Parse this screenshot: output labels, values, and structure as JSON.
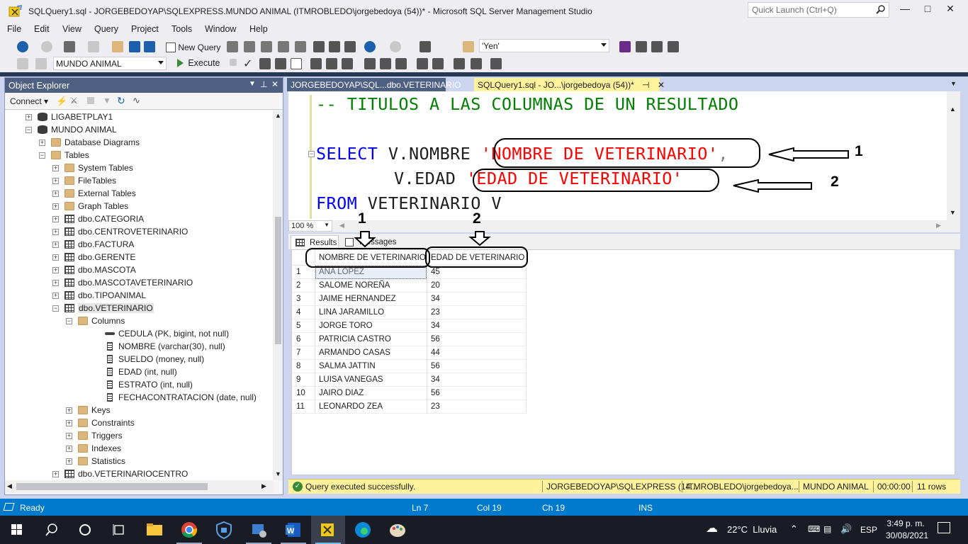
{
  "window": {
    "title": "SQLQuery1.sql - JORGEBEDOYAP\\SQLEXPRESS.MUNDO ANIMAL (ITMROBLEDO\\jorgebedoya (54))* - Microsoft SQL Server Management Studio"
  },
  "quick_launch": {
    "placeholder": "Quick Launch (Ctrl+Q)"
  },
  "menu": [
    "File",
    "Edit",
    "View",
    "Query",
    "Project",
    "Tools",
    "Window",
    "Help"
  ],
  "toolbar": {
    "new_query": "New Query",
    "search_combo": "'Yen'",
    "database": "MUNDO ANIMAL",
    "execute": "Execute"
  },
  "object_explorer": {
    "title": "Object Explorer",
    "connect": "Connect",
    "tree": [
      {
        "label": "LIGABETPLAY1",
        "icon": "database-icon",
        "exp": "+",
        "level": 0
      },
      {
        "label": "MUNDO ANIMAL",
        "icon": "database-icon",
        "exp": "-",
        "level": 0
      },
      {
        "label": "Database Diagrams",
        "icon": "folder-icon",
        "exp": "+",
        "level": 1
      },
      {
        "label": "Tables",
        "icon": "folder-icon",
        "exp": "-",
        "level": 1
      },
      {
        "label": "System Tables",
        "icon": "folder-icon",
        "exp": "+",
        "level": 2
      },
      {
        "label": "FileTables",
        "icon": "folder-icon",
        "exp": "+",
        "level": 2
      },
      {
        "label": "External Tables",
        "icon": "folder-icon",
        "exp": "+",
        "level": 2
      },
      {
        "label": "Graph Tables",
        "icon": "folder-icon",
        "exp": "+",
        "level": 2
      },
      {
        "label": "dbo.CATEGORIA",
        "icon": "table-icon",
        "exp": "+",
        "level": 2
      },
      {
        "label": "dbo.CENTROVETERINARIO",
        "icon": "table-icon",
        "exp": "+",
        "level": 2
      },
      {
        "label": "dbo.FACTURA",
        "icon": "table-icon",
        "exp": "+",
        "level": 2
      },
      {
        "label": "dbo.GERENTE",
        "icon": "table-icon",
        "exp": "+",
        "level": 2
      },
      {
        "label": "dbo.MASCOTA",
        "icon": "table-icon",
        "exp": "+",
        "level": 2
      },
      {
        "label": "dbo.MASCOTAVETERINARIO",
        "icon": "table-icon",
        "exp": "+",
        "level": 2
      },
      {
        "label": "dbo.TIPOANIMAL",
        "icon": "table-icon",
        "exp": "+",
        "level": 2
      },
      {
        "label": "dbo.VETERINARIO",
        "icon": "table-icon",
        "exp": "-",
        "level": 2
      },
      {
        "label": "Columns",
        "icon": "folder-icon",
        "exp": "-",
        "level": 3
      },
      {
        "label": "CEDULA (PK, bigint, not null)",
        "icon": "key-icon",
        "exp": "",
        "level": 4
      },
      {
        "label": "NOMBRE (varchar(30), null)",
        "icon": "column-icon",
        "exp": "",
        "level": 4
      },
      {
        "label": "SUELDO (money, null)",
        "icon": "column-icon",
        "exp": "",
        "level": 4
      },
      {
        "label": "EDAD (int, null)",
        "icon": "column-icon",
        "exp": "",
        "level": 4
      },
      {
        "label": "ESTRATO (int, null)",
        "icon": "column-icon",
        "exp": "",
        "level": 4
      },
      {
        "label": "FECHACONTRATACION (date, null)",
        "icon": "column-icon",
        "exp": "",
        "level": 4
      },
      {
        "label": "Keys",
        "icon": "folder-icon",
        "exp": "+",
        "level": 3
      },
      {
        "label": "Constraints",
        "icon": "folder-icon",
        "exp": "+",
        "level": 3
      },
      {
        "label": "Triggers",
        "icon": "folder-icon",
        "exp": "+",
        "level": 3
      },
      {
        "label": "Indexes",
        "icon": "folder-icon",
        "exp": "+",
        "level": 3
      },
      {
        "label": "Statistics",
        "icon": "folder-icon",
        "exp": "+",
        "level": 3
      },
      {
        "label": "dbo.VETERINARIOCENTRO",
        "icon": "table-icon",
        "exp": "+",
        "level": 2
      }
    ]
  },
  "doc_tabs": {
    "tab1": "JORGEBEDOYAP\\SQL...dbo.VETERINARIO",
    "tab2": "SQLQuery1.sql - JO...\\jorgebedoya (54))*",
    "tab2_pin": "⊣",
    "tab2_close": "✕"
  },
  "editor": {
    "comment": "-- TITULOS A LAS COLUMNAS DE UN RESULTADO",
    "select_kw": "SELECT",
    "line2_mid": " V.NOMBRE ",
    "alias1": "'NOMBRE DE VETERINARIO'",
    "comma": ",",
    "line3_mid": "V.EDAD ",
    "alias2": "'EDAD DE VETERINARIO'",
    "from_kw": "FROM",
    "line4_rest": " VETERINARIO V",
    "zoom": "100 %"
  },
  "annotations": {
    "n1": "1",
    "n2": "2"
  },
  "results": {
    "tab_results": "Results",
    "tab_messages": "Messages",
    "columns": [
      "NOMBRE DE VETERINARIO",
      "EDAD DE VETERINARIO"
    ],
    "rows": [
      [
        "1",
        "ANA LOPEZ",
        "45"
      ],
      [
        "2",
        "SALOME NOREÑA",
        "20"
      ],
      [
        "3",
        "JAIME HERNANDEZ",
        "34"
      ],
      [
        "4",
        "LINA JARAMILLO",
        "23"
      ],
      [
        "5",
        "JORGE TORO",
        "34"
      ],
      [
        "6",
        "PATRICIA CASTRO",
        "56"
      ],
      [
        "7",
        "ARMANDO CASAS",
        "44"
      ],
      [
        "8",
        "SALMA JATTIN",
        "56"
      ],
      [
        "9",
        "LUISA VANEGAS",
        "34"
      ],
      [
        "10",
        "JAIRO DIAZ",
        "56"
      ],
      [
        "11",
        "LEONARDO ZEA",
        "23"
      ]
    ]
  },
  "query_status": {
    "message": "Query executed successfully.",
    "server": "JORGEBEDOYAP\\SQLEXPRESS (14...",
    "user": "ITMROBLEDO\\jorgebedoya...",
    "database": "MUNDO ANIMAL",
    "time": "00:00:00",
    "rows": "11 rows"
  },
  "status_bar": {
    "ready": "Ready",
    "ln": "Ln 7",
    "col": "Col 19",
    "ch": "Ch 19",
    "mode": "INS"
  },
  "taskbar": {
    "weather": "22°C  Lluvia",
    "lang": "ESP",
    "time": "3:49 p. m.",
    "date": "30/08/2021"
  },
  "colors": {
    "accent": "#007acc",
    "oe_header": "#4d6082",
    "active_tab": "#fff29d",
    "keyword": "#0000ff",
    "string": "#ff0000",
    "comment": "#008000"
  }
}
